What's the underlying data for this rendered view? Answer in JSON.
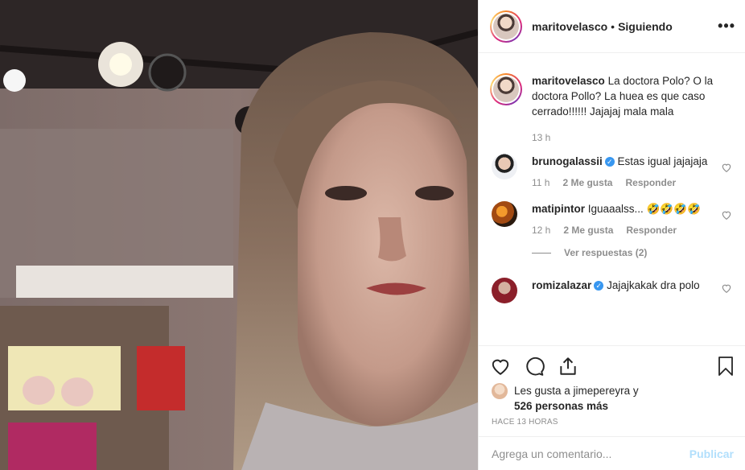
{
  "post": {
    "username": "maritovelasco",
    "separator": "•",
    "follow_status": "Siguiendo",
    "more_icon": "more-horizontal-icon",
    "caption": "La doctora Polo? O la doctora Pollo? La huea es que caso cerrado!!!!!! Jajajaj mala mala",
    "caption_time": "13 h"
  },
  "comments": [
    {
      "username": "brunogalassii",
      "verified": true,
      "text": "Estas igual jajajaja",
      "time": "11 h",
      "likes": "2 Me gusta",
      "reply": "Responder"
    },
    {
      "username": "matipintor",
      "verified": false,
      "text": "Iguaaalss... 🤣🤣🤣🤣",
      "time": "12 h",
      "likes": "2 Me gusta",
      "reply": "Responder"
    },
    {
      "username": "romizalazar",
      "verified": true,
      "text": "Jajajkakak dra polo",
      "time": "",
      "likes": "",
      "reply": ""
    }
  ],
  "view_replies": "Ver respuestas (2)",
  "likes_line1": "Les gusta a jimepereyra y",
  "likes_line2": "526 personas más",
  "timestamp": "HACE 13 HORAS",
  "add_comment": {
    "placeholder": "Agrega un comentario...",
    "button": "Publicar"
  },
  "colors": {
    "accent": "#3897f0",
    "publish_disabled": "#b2dffc",
    "muted": "#8e8e8e"
  }
}
